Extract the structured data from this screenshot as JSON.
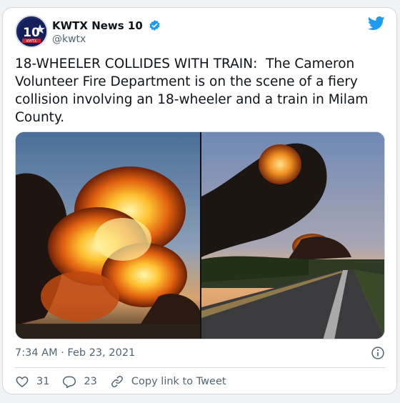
{
  "account": {
    "display_name": "KWTX News 10",
    "handle": "@kwtx",
    "avatar_text": "10",
    "avatar_subtext": "KWTX",
    "verified": true
  },
  "tweet": {
    "text": "18-WHEELER COLLIDES WITH TRAIN:  The Cameron Volunteer Fire Department is on the scene of a fiery collision involving an 18-wheeler and a train in Milam County.",
    "timestamp": "7:34 AM · Feb 23, 2021"
  },
  "actions": {
    "likes": "31",
    "replies": "23",
    "copy_link_label": "Copy link to Tweet"
  },
  "icons": {
    "brand": "twitter-bird-icon",
    "verified": "verified-badge-icon",
    "info": "info-icon",
    "like": "heart-icon",
    "reply": "reply-bubble-icon",
    "link": "link-icon"
  },
  "colors": {
    "twitter_blue": "#1d9bf0",
    "text_primary": "#0f1419",
    "text_secondary": "#536471",
    "border": "#cfd9de"
  }
}
